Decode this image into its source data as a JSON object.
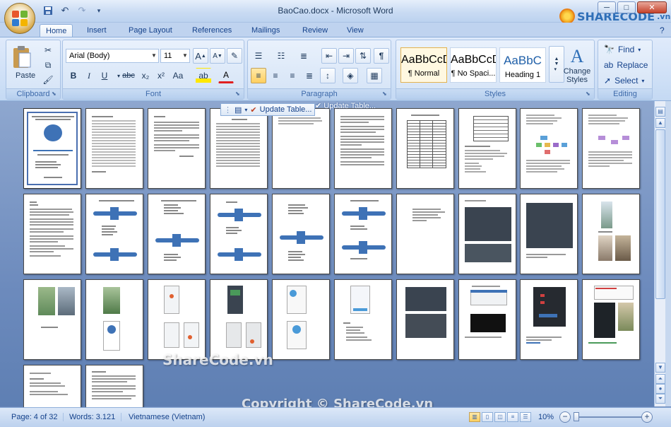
{
  "window": {
    "title": "BaoCao.docx - Microsoft Word",
    "controls": {
      "minimize": "─",
      "maximize": "□",
      "close": "✕"
    }
  },
  "quick_access": [
    "save-icon",
    "undo-icon",
    "redo-icon",
    "customize-icon"
  ],
  "tabs": [
    "Home",
    "Insert",
    "Page Layout",
    "References",
    "Mailings",
    "Review",
    "View"
  ],
  "active_tab": "Home",
  "ribbon": {
    "clipboard": {
      "label": "Clipboard",
      "paste": "Paste"
    },
    "font": {
      "label": "Font",
      "name": "Arial (Body)",
      "size": "11",
      "grow": "A",
      "shrink": "A",
      "bold": "B",
      "italic": "I",
      "underline": "U",
      "strike": "abc",
      "sub": "x₂",
      "sup": "x²",
      "case": "Aa",
      "color": "A",
      "highlight": "ab"
    },
    "paragraph": {
      "label": "Paragraph",
      "pilcrow": "¶"
    },
    "styles": {
      "label": "Styles",
      "items": [
        {
          "sample": "AaBbCcD",
          "name": "¶ Normal"
        },
        {
          "sample": "AaBbCcD",
          "name": "¶ No Spaci..."
        },
        {
          "sample": "AaBbC",
          "name": "Heading 1"
        }
      ],
      "change_styles": [
        "Change",
        "Styles"
      ]
    },
    "editing": {
      "label": "Editing",
      "find": "Find",
      "replace": "Replace",
      "select": "Select"
    }
  },
  "floating_toolbar": {
    "update_table": "Update Table...",
    "update_table_2": "Update Table..."
  },
  "status": {
    "page": "Page: 4 of 32",
    "words": "Words: 3.121",
    "language": "Vietnamese (Vietnam)",
    "zoom": "10%",
    "zoom_minus": "−",
    "zoom_plus": "+",
    "zoom_level": 0.1
  },
  "watermarks": {
    "brand": "SHARECODE",
    "brand_suffix": ".vn",
    "center": "ShareCode.vn",
    "footer": "Copyright © ShareCode.vn"
  },
  "colors": {
    "ribbon": "#cddff6",
    "doc_bg": "#6d8bbd",
    "accent": "#15428b"
  }
}
